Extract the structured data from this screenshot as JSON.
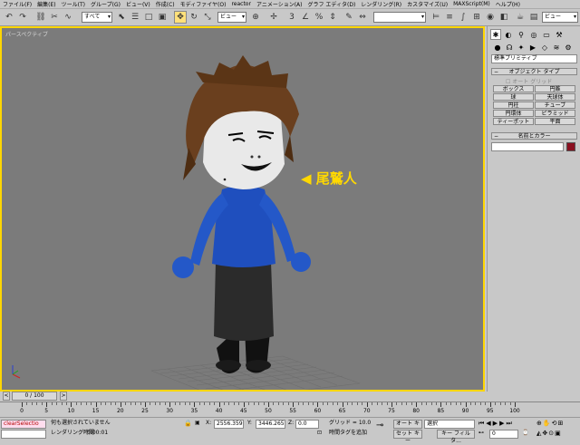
{
  "menubar": {
    "items": [
      "ファイル(F)",
      "編集(E)",
      "ツール(T)",
      "グループ(G)",
      "ビュー(V)",
      "作成(C)",
      "モディファイヤ(O)",
      "reactor",
      "アニメーション(A)",
      "グラフ エディタ(D)",
      "レンダリング(R)",
      "カスタマイズ(U)",
      "MAXScript(M)",
      "ヘルプ(H)"
    ]
  },
  "toolbar": {
    "selection_filter": "すべて",
    "reference_coord": "ビュー",
    "named_selection": "",
    "view_dropdown": "ビュー"
  },
  "viewport": {
    "label": "パースペクティブ",
    "annotation": "◀ 尾鷲人"
  },
  "command_panel": {
    "category_dropdown": "標準プリミティブ",
    "object_type_title": "オブジェクト タイプ",
    "autogrid_label": "オート グリッド",
    "buttons": [
      "ボックス",
      "円錐",
      "球",
      "天球体",
      "円柱",
      "チューブ",
      "円環体",
      "ピラミッド",
      "ティーポット",
      "平面"
    ],
    "name_color_title": "名前とカラー",
    "name_value": "",
    "object_color": "#8a1020"
  },
  "timeline": {
    "frame_display": "0 / 100",
    "ticks": [
      "0",
      "5",
      "10",
      "15",
      "20",
      "25",
      "30",
      "35",
      "40",
      "45",
      "50",
      "55",
      "60",
      "65",
      "70",
      "75",
      "80",
      "85",
      "90",
      "95",
      "100"
    ]
  },
  "status": {
    "maxscript_listener": "clearSelectio",
    "selection_message": "何も選択されていません",
    "render_time_label": "レンダリング時間",
    "render_time_value": "0:00:01",
    "x_label": "X:",
    "x_value": "2556.359",
    "y_label": "Y:",
    "y_value": "3446.265",
    "z_label": "Z:",
    "z_value": "0.0",
    "grid": "グリッド = 10.0",
    "add_time_tag": "時間タグを追加",
    "autokey": "オート キー",
    "setkey": "セット キー",
    "selected_dropdown": "選択",
    "key_filters": "キー フィルタ...",
    "frame_field": "0"
  }
}
